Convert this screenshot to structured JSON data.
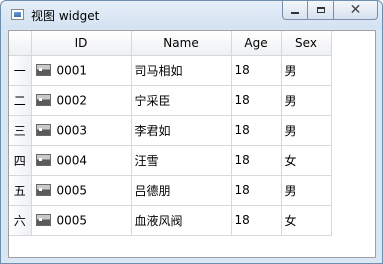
{
  "window": {
    "title": "视图 widget",
    "close_symbol": "✕"
  },
  "table": {
    "headers": [
      "ID",
      "Name",
      "Age",
      "Sex"
    ],
    "rows": [
      {
        "row_header": "一",
        "id": "0001",
        "name": "司马相如",
        "age": "18",
        "sex": "男"
      },
      {
        "row_header": "二",
        "id": "0002",
        "name": "宁采臣",
        "age": "18",
        "sex": "男"
      },
      {
        "row_header": "三",
        "id": "0003",
        "name": "李君如",
        "age": "18",
        "sex": "男"
      },
      {
        "row_header": "四",
        "id": "0004",
        "name": "汪雪",
        "age": "18",
        "sex": "女"
      },
      {
        "row_header": "五",
        "id": "0005",
        "name": "吕德朋",
        "age": "18",
        "sex": "男"
      },
      {
        "row_header": "六",
        "id": "0005",
        "name": "血液风阀",
        "age": "18",
        "sex": "女"
      }
    ],
    "row_icon": "image-icon"
  }
}
